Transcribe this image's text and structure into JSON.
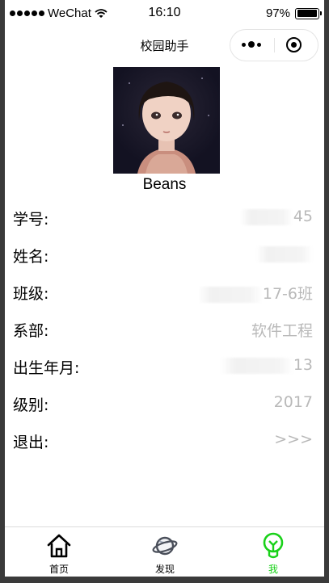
{
  "status_bar": {
    "carrier": "WeChat",
    "time": "16:10",
    "battery": "97%",
    "battery_level": 0.97
  },
  "nav": {
    "title": "校园助手"
  },
  "profile": {
    "username": "Beans"
  },
  "rows": [
    {
      "label": "学号:",
      "value": "45"
    },
    {
      "label": "姓名:",
      "value": ""
    },
    {
      "label": "班级:",
      "value": "17-6班"
    },
    {
      "label": "系部:",
      "value": "软件工程"
    },
    {
      "label": "出生年月:",
      "value": "13"
    },
    {
      "label": "级别:",
      "value": "2017"
    },
    {
      "label": "退出:",
      "value": ">>>"
    }
  ],
  "tabs": [
    {
      "label": "首页",
      "icon": "home-icon"
    },
    {
      "label": "发现",
      "icon": "planet-icon"
    },
    {
      "label": "我",
      "icon": "lightbulb-icon"
    }
  ],
  "colors": {
    "active_tab": "#19d119",
    "value_text": "#b9b9b9"
  }
}
